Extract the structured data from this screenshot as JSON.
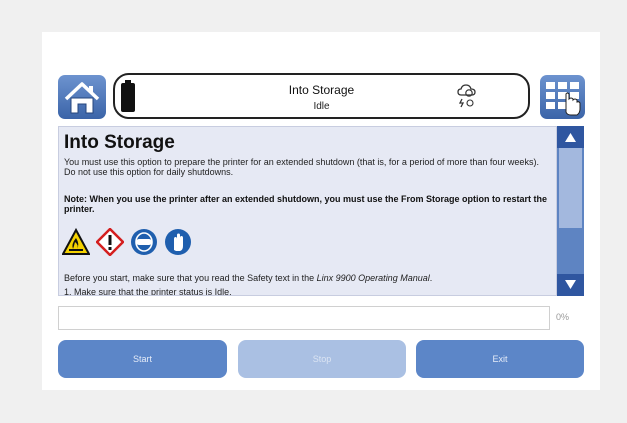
{
  "header": {
    "title": "Into Storage",
    "status": "Idle",
    "icons": [
      "home-icon",
      "battery-icon",
      "cloud-sync-icon",
      "grid-menu-icon"
    ]
  },
  "content": {
    "heading": "Into Storage",
    "para1": "You must use this option to prepare the printer for an extended shutdown (that is, for a period of more than four weeks). Do not use this option for daily shutdowns.",
    "note": "Note: When you use the printer after an extended shutdown, you must use the From Storage option to restart the printer.",
    "safety_icons": [
      "flammable-warning-icon",
      "harmful-diamond-icon",
      "eye-protection-icon",
      "glove-icon"
    ],
    "para3_prefix": "Before you start, make sure that you read the Safety text in the ",
    "para3_italic": "Linx 9900 Operating Manual",
    "para3_suffix": ".",
    "step1": "1. Make sure that the printer status is Idle."
  },
  "progress": {
    "value": 0,
    "label": "0%"
  },
  "buttons": {
    "start": "Start",
    "stop": "Stop",
    "exit": "Exit"
  },
  "colors": {
    "accent": "#5c86c8",
    "accent_dark": "#2f56a0",
    "content_bg": "#e6e9f4"
  }
}
